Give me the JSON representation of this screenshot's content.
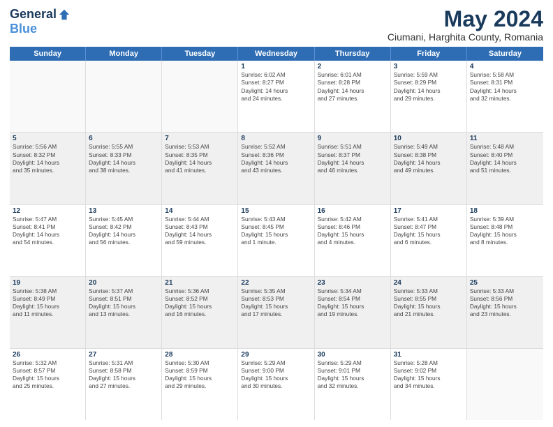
{
  "header": {
    "logo_general": "General",
    "logo_blue": "Blue",
    "month_title": "May 2024",
    "location": "Ciumani, Harghita County, Romania"
  },
  "weekdays": [
    "Sunday",
    "Monday",
    "Tuesday",
    "Wednesday",
    "Thursday",
    "Friday",
    "Saturday"
  ],
  "rows": [
    [
      {
        "day": "",
        "text": ""
      },
      {
        "day": "",
        "text": ""
      },
      {
        "day": "",
        "text": ""
      },
      {
        "day": "1",
        "text": "Sunrise: 6:02 AM\nSunset: 8:27 PM\nDaylight: 14 hours\nand 24 minutes."
      },
      {
        "day": "2",
        "text": "Sunrise: 6:01 AM\nSunset: 8:28 PM\nDaylight: 14 hours\nand 27 minutes."
      },
      {
        "day": "3",
        "text": "Sunrise: 5:59 AM\nSunset: 8:29 PM\nDaylight: 14 hours\nand 29 minutes."
      },
      {
        "day": "4",
        "text": "Sunrise: 5:58 AM\nSunset: 8:31 PM\nDaylight: 14 hours\nand 32 minutes."
      }
    ],
    [
      {
        "day": "5",
        "text": "Sunrise: 5:56 AM\nSunset: 8:32 PM\nDaylight: 14 hours\nand 35 minutes."
      },
      {
        "day": "6",
        "text": "Sunrise: 5:55 AM\nSunset: 8:33 PM\nDaylight: 14 hours\nand 38 minutes."
      },
      {
        "day": "7",
        "text": "Sunrise: 5:53 AM\nSunset: 8:35 PM\nDaylight: 14 hours\nand 41 minutes."
      },
      {
        "day": "8",
        "text": "Sunrise: 5:52 AM\nSunset: 8:36 PM\nDaylight: 14 hours\nand 43 minutes."
      },
      {
        "day": "9",
        "text": "Sunrise: 5:51 AM\nSunset: 8:37 PM\nDaylight: 14 hours\nand 46 minutes."
      },
      {
        "day": "10",
        "text": "Sunrise: 5:49 AM\nSunset: 8:38 PM\nDaylight: 14 hours\nand 49 minutes."
      },
      {
        "day": "11",
        "text": "Sunrise: 5:48 AM\nSunset: 8:40 PM\nDaylight: 14 hours\nand 51 minutes."
      }
    ],
    [
      {
        "day": "12",
        "text": "Sunrise: 5:47 AM\nSunset: 8:41 PM\nDaylight: 14 hours\nand 54 minutes."
      },
      {
        "day": "13",
        "text": "Sunrise: 5:45 AM\nSunset: 8:42 PM\nDaylight: 14 hours\nand 56 minutes."
      },
      {
        "day": "14",
        "text": "Sunrise: 5:44 AM\nSunset: 8:43 PM\nDaylight: 14 hours\nand 59 minutes."
      },
      {
        "day": "15",
        "text": "Sunrise: 5:43 AM\nSunset: 8:45 PM\nDaylight: 15 hours\nand 1 minute."
      },
      {
        "day": "16",
        "text": "Sunrise: 5:42 AM\nSunset: 8:46 PM\nDaylight: 15 hours\nand 4 minutes."
      },
      {
        "day": "17",
        "text": "Sunrise: 5:41 AM\nSunset: 8:47 PM\nDaylight: 15 hours\nand 6 minutes."
      },
      {
        "day": "18",
        "text": "Sunrise: 5:39 AM\nSunset: 8:48 PM\nDaylight: 15 hours\nand 8 minutes."
      }
    ],
    [
      {
        "day": "19",
        "text": "Sunrise: 5:38 AM\nSunset: 8:49 PM\nDaylight: 15 hours\nand 11 minutes."
      },
      {
        "day": "20",
        "text": "Sunrise: 5:37 AM\nSunset: 8:51 PM\nDaylight: 15 hours\nand 13 minutes."
      },
      {
        "day": "21",
        "text": "Sunrise: 5:36 AM\nSunset: 8:52 PM\nDaylight: 15 hours\nand 16 minutes."
      },
      {
        "day": "22",
        "text": "Sunrise: 5:35 AM\nSunset: 8:53 PM\nDaylight: 15 hours\nand 17 minutes."
      },
      {
        "day": "23",
        "text": "Sunrise: 5:34 AM\nSunset: 8:54 PM\nDaylight: 15 hours\nand 19 minutes."
      },
      {
        "day": "24",
        "text": "Sunrise: 5:33 AM\nSunset: 8:55 PM\nDaylight: 15 hours\nand 21 minutes."
      },
      {
        "day": "25",
        "text": "Sunrise: 5:33 AM\nSunset: 8:56 PM\nDaylight: 15 hours\nand 23 minutes."
      }
    ],
    [
      {
        "day": "26",
        "text": "Sunrise: 5:32 AM\nSunset: 8:57 PM\nDaylight: 15 hours\nand 25 minutes."
      },
      {
        "day": "27",
        "text": "Sunrise: 5:31 AM\nSunset: 8:58 PM\nDaylight: 15 hours\nand 27 minutes."
      },
      {
        "day": "28",
        "text": "Sunrise: 5:30 AM\nSunset: 8:59 PM\nDaylight: 15 hours\nand 29 minutes."
      },
      {
        "day": "29",
        "text": "Sunrise: 5:29 AM\nSunset: 9:00 PM\nDaylight: 15 hours\nand 30 minutes."
      },
      {
        "day": "30",
        "text": "Sunrise: 5:29 AM\nSunset: 9:01 PM\nDaylight: 15 hours\nand 32 minutes."
      },
      {
        "day": "31",
        "text": "Sunrise: 5:28 AM\nSunset: 9:02 PM\nDaylight: 15 hours\nand 34 minutes."
      },
      {
        "day": "",
        "text": ""
      }
    ]
  ]
}
